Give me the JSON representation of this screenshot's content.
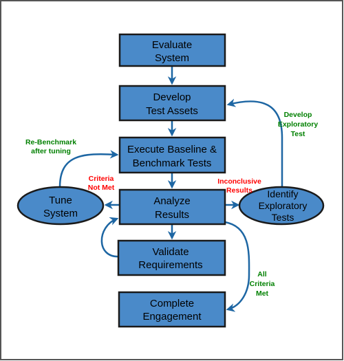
{
  "colors": {
    "box_fill": "#4a8ac9",
    "arrow": "#1d66a3",
    "positive_label": "#008000",
    "negative_label": "#ff0000"
  },
  "nodes": {
    "evaluate": [
      "Evaluate",
      "System"
    ],
    "develop": [
      "Develop",
      "Test Assets"
    ],
    "execute": [
      "Execute Baseline &",
      "Benchmark Tests"
    ],
    "analyze": [
      "Analyze",
      "Results"
    ],
    "validate": [
      "Validate",
      "Requirements"
    ],
    "complete": [
      "Complete",
      "Engagement"
    ],
    "tune": [
      "Tune",
      "System"
    ],
    "identify": [
      "Identify",
      "Exploratory",
      "Tests"
    ]
  },
  "edge_labels": {
    "rebenchmark": [
      "Re-Benchmark",
      "after tuning"
    ],
    "criteria_not_met": [
      "Criteria",
      "Not Met"
    ],
    "inconclusive": [
      "Inconclusive",
      "Results"
    ],
    "develop_exploratory": [
      "Develop",
      "Exploratory",
      "Test"
    ],
    "all_criteria_met": [
      "All",
      "Criteria",
      "Met"
    ]
  }
}
